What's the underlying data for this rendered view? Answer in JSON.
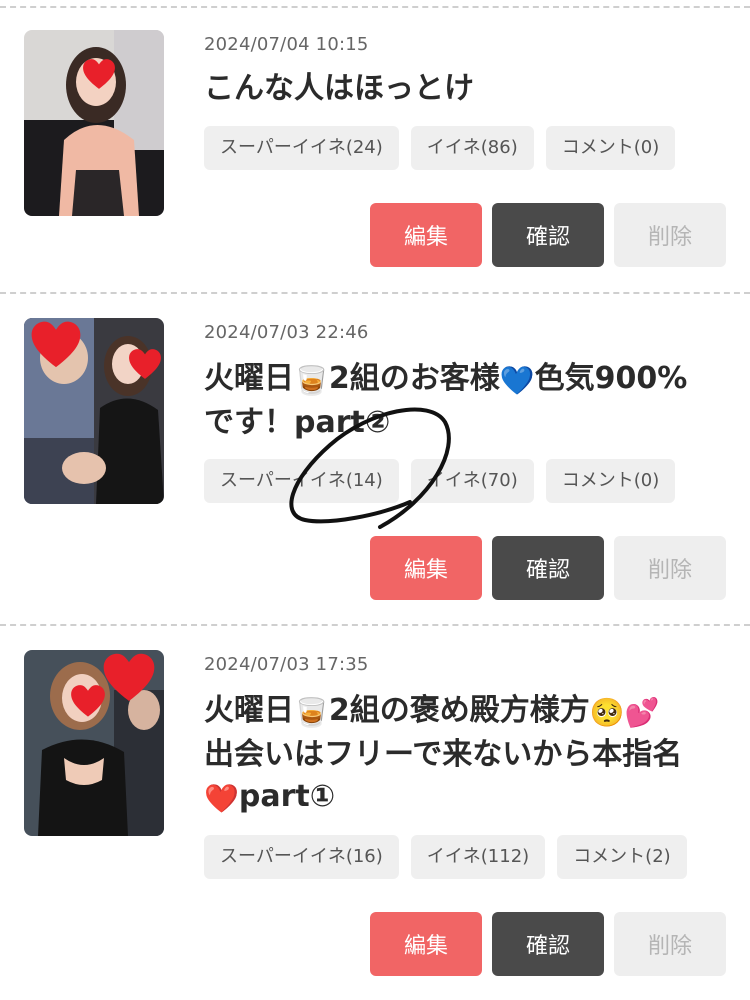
{
  "posts": [
    {
      "date": "2024/07/04 10:15",
      "title_parts": [
        "こんな人はほっとけ"
      ],
      "tags": {
        "super_like": "スーパーイイネ(24)",
        "like": "イイネ(86)",
        "comment": "コメント(0)"
      },
      "buttons": {
        "edit": "編集",
        "confirm": "確認",
        "delete": "削除"
      }
    },
    {
      "date": "2024/07/03 22:46",
      "title_parts": [
        "火曜日",
        "🥃",
        "2組のお客様",
        "💙",
        "色気900%",
        "です！part②"
      ],
      "tags": {
        "super_like": "スーパーイイネ(14)",
        "like": "イイネ(70)",
        "comment": "コメント(0)"
      },
      "buttons": {
        "edit": "編集",
        "confirm": "確認",
        "delete": "削除"
      }
    },
    {
      "date": "2024/07/03 17:35",
      "title_parts": [
        "火曜日",
        "🥃",
        "2組の褒め殿方様方",
        "🥺",
        "💕",
        "出会いはフリーで来ないから本指名",
        "❤️",
        "part①"
      ],
      "tags": {
        "super_like": "スーパーイイネ(16)",
        "like": "イイネ(112)",
        "comment": "コメント(2)"
      },
      "buttons": {
        "edit": "編集",
        "confirm": "確認",
        "delete": "削除"
      }
    }
  ],
  "icons": {
    "heart_sticker": "heart-icon"
  },
  "colors": {
    "edit": "#f16565",
    "confirm": "#4a4a4a",
    "delete": "#eeeeee",
    "tag_bg": "#efefef",
    "heart": "#e8202a"
  }
}
